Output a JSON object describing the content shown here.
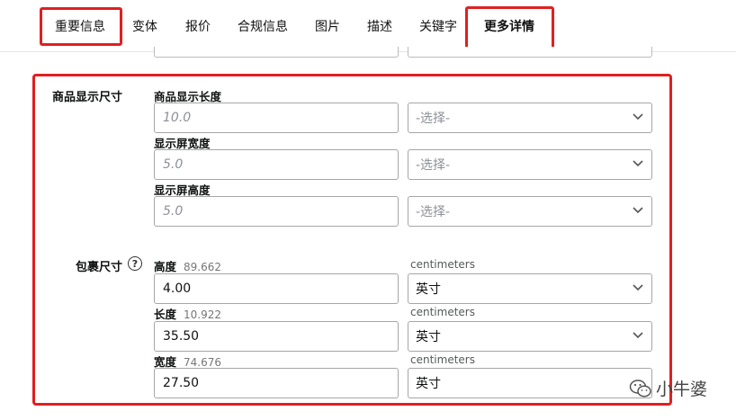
{
  "tabs": [
    {
      "label": "重要信息",
      "bold": false
    },
    {
      "label": "变体",
      "bold": false
    },
    {
      "label": "报价",
      "bold": false
    },
    {
      "label": "合规信息",
      "bold": false
    },
    {
      "label": "图片",
      "bold": false
    },
    {
      "label": "描述",
      "bold": false
    },
    {
      "label": "关键字",
      "bold": false
    },
    {
      "label": "更多详情",
      "bold": true
    }
  ],
  "display_dims": {
    "section_label": "商品显示尺寸",
    "fields": [
      {
        "label": "商品显示长度",
        "placeholder": "10.0",
        "select": "-选择-"
      },
      {
        "label": "显示屏宽度",
        "placeholder": "5.0",
        "select": "-选择-"
      },
      {
        "label": "显示屏高度",
        "placeholder": "5.0",
        "select": "-选择-"
      }
    ]
  },
  "package_dims": {
    "section_label": "包裹尺寸",
    "help_glyph": "?",
    "fields": [
      {
        "label": "高度",
        "hint": "89.662",
        "unit_label": "centimeters",
        "value": "4.00",
        "select": "英寸",
        "has_chevron": true
      },
      {
        "label": "长度",
        "hint": "10.922",
        "unit_label": "centimeters",
        "value": "35.50",
        "select": "英寸",
        "has_chevron": true
      },
      {
        "label": "宽度",
        "hint": "74.676",
        "unit_label": "centimeters",
        "value": "27.50",
        "select": "英寸",
        "has_chevron": false
      }
    ]
  },
  "watermark": {
    "text": "小牛婆"
  },
  "colors": {
    "highlight": "#e02020",
    "border": "#a6a6a6"
  },
  "icons": [
    "chevron-down-icon",
    "help-icon",
    "wechat-icon"
  ]
}
